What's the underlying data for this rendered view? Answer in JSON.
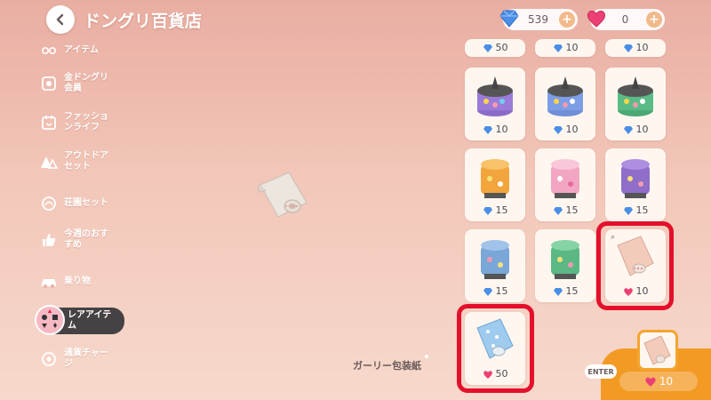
{
  "header": {
    "title": "ドングリ百貨店",
    "currencies": [
      {
        "icon": "blue-gem-icon",
        "amount": "539"
      },
      {
        "icon": "pink-gem-icon",
        "amount": "0"
      }
    ]
  },
  "sidebar": {
    "items": [
      {
        "label": "アイテム",
        "icon": "item-icon"
      },
      {
        "label": "金ドングリ\n会員",
        "icon": "membership-icon"
      },
      {
        "label": "ファッショ\nンライフ",
        "icon": "fashion-icon"
      },
      {
        "label": "アウトドア\nセット",
        "icon": "tent-icon"
      },
      {
        "label": "荘園セット",
        "icon": "manor-icon"
      },
      {
        "label": "今週のおす\nすめ",
        "icon": "thumbs-up-icon"
      },
      {
        "label": "乗り物",
        "icon": "vehicle-icon"
      },
      {
        "label": "レアアイテ\nム",
        "icon": "rare-item-icon",
        "active": true
      },
      {
        "label": "通貨チャー\nジ",
        "icon": "currency-charge-icon"
      }
    ]
  },
  "preview": {
    "name": "ガーリー包装紙"
  },
  "grid": {
    "partial_row": [
      "50",
      "10",
      "10"
    ],
    "rows": [
      [
        {
          "price": "10",
          "gem": "blue",
          "art": "purple-cake"
        },
        {
          "price": "10",
          "gem": "blue",
          "art": "blue-cake"
        },
        {
          "price": "10",
          "gem": "blue",
          "art": "green-cake"
        }
      ],
      [
        {
          "price": "15",
          "gem": "blue",
          "art": "orange-tower"
        },
        {
          "price": "15",
          "gem": "blue",
          "art": "pink-tower"
        },
        {
          "price": "15",
          "gem": "blue",
          "art": "purple-tower"
        }
      ],
      [
        {
          "price": "15",
          "gem": "blue",
          "art": "blue-tower"
        },
        {
          "price": "15",
          "gem": "blue",
          "art": "green-tower"
        },
        {
          "price": "10",
          "gem": "pink",
          "art": "pink-wrap",
          "highlight": true
        }
      ],
      [
        {
          "price": "50",
          "gem": "pink",
          "art": "blue-wrap",
          "highlight": true
        }
      ]
    ]
  },
  "confirm": {
    "enter_label": "ENTER",
    "price": "10",
    "gem": "pink"
  },
  "colors": {
    "accent": "#f39a25",
    "highlight": "#e4102b",
    "blue_gem": "#4a8ee6",
    "pink_gem": "#ec3f74"
  }
}
